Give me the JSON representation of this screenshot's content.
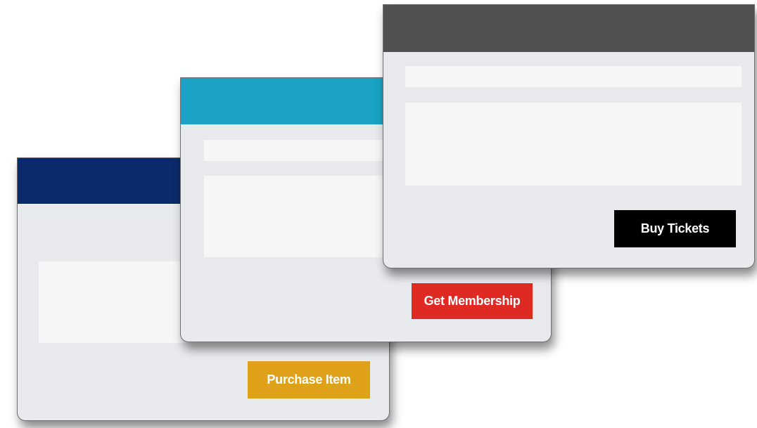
{
  "cards": {
    "purchase": {
      "header_color": "#0b2a6b",
      "button_label": "Purchase Item",
      "button_color": "#e0a11a"
    },
    "membership": {
      "header_color": "#1aa3c4",
      "button_label": "Get Membership",
      "button_color": "#df2a23"
    },
    "tickets": {
      "header_color": "#505050",
      "button_label": "Buy Tickets",
      "button_color": "#000000"
    }
  }
}
